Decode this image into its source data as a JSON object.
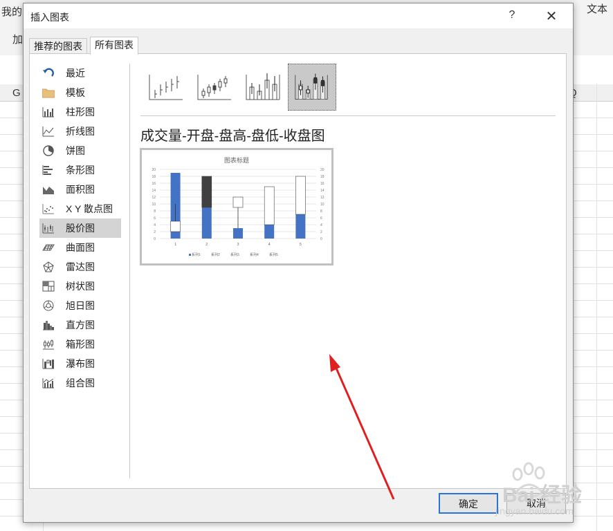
{
  "background": {
    "ribbon_top_text": [
      "我的",
      "文本"
    ],
    "ribbon_row2_text": "加",
    "left_col_header": "G",
    "right_col_header": "Q"
  },
  "dialog": {
    "title": "插入图表",
    "help_glyph": "?",
    "close_glyph": "✕",
    "tabs": [
      {
        "label": "推荐的图表",
        "active": false
      },
      {
        "label": "所有图表",
        "active": true
      }
    ],
    "sidebar": [
      {
        "label": "最近",
        "icon": "recent-icon"
      },
      {
        "label": "模板",
        "icon": "folder-icon"
      },
      {
        "label": "柱形图",
        "icon": "column-chart-icon"
      },
      {
        "label": "折线图",
        "icon": "line-chart-icon"
      },
      {
        "label": "饼图",
        "icon": "pie-chart-icon"
      },
      {
        "label": "条形图",
        "icon": "bar-chart-icon"
      },
      {
        "label": "面积图",
        "icon": "area-chart-icon"
      },
      {
        "label": "X Y 散点图",
        "icon": "scatter-chart-icon"
      },
      {
        "label": "股价图",
        "icon": "stock-chart-icon",
        "selected": true
      },
      {
        "label": "曲面图",
        "icon": "surface-chart-icon"
      },
      {
        "label": "雷达图",
        "icon": "radar-chart-icon"
      },
      {
        "label": "树状图",
        "icon": "treemap-chart-icon"
      },
      {
        "label": "旭日图",
        "icon": "sunburst-chart-icon"
      },
      {
        "label": "直方图",
        "icon": "histogram-chart-icon"
      },
      {
        "label": "箱形图",
        "icon": "box-chart-icon"
      },
      {
        "label": "瀑布图",
        "icon": "waterfall-chart-icon"
      },
      {
        "label": "组合图",
        "icon": "combo-chart-icon"
      }
    ],
    "subtypes": [
      {
        "icon": "hlc-stock-icon",
        "selected": false
      },
      {
        "icon": "ohlc-stock-icon",
        "selected": false
      },
      {
        "icon": "vhlc-stock-icon",
        "selected": false
      },
      {
        "icon": "vohlc-stock-icon",
        "selected": true
      }
    ],
    "selected_chart_name": "成交量-开盘-盘高-盘低-收盘图",
    "preview": {
      "title": "图表标题",
      "legend": [
        "系列1",
        "系列2",
        "系列3",
        "系列4",
        "系列5"
      ],
      "categories": [
        "1",
        "2",
        "3",
        "4",
        "5"
      ],
      "y_ticks": [
        "20",
        "18",
        "16",
        "14",
        "12",
        "10",
        "8",
        "6",
        "4",
        "2",
        "0"
      ],
      "volume": [
        19,
        9,
        3,
        4,
        7
      ],
      "open": [
        2,
        18,
        9,
        4,
        7
      ],
      "high": [
        10,
        18,
        12,
        15,
        18
      ],
      "low": [
        2,
        9,
        3,
        4,
        7
      ],
      "close": [
        5,
        9,
        12,
        15,
        18
      ],
      "colors": {
        "volume": "#4472c4",
        "down_box": "#404040",
        "up_box": "#ffffff"
      }
    },
    "buttons": {
      "ok": "确定",
      "cancel": "取消"
    }
  },
  "watermark": {
    "text": "Bai 经验",
    "sub": "jingyan.baidu.com"
  }
}
